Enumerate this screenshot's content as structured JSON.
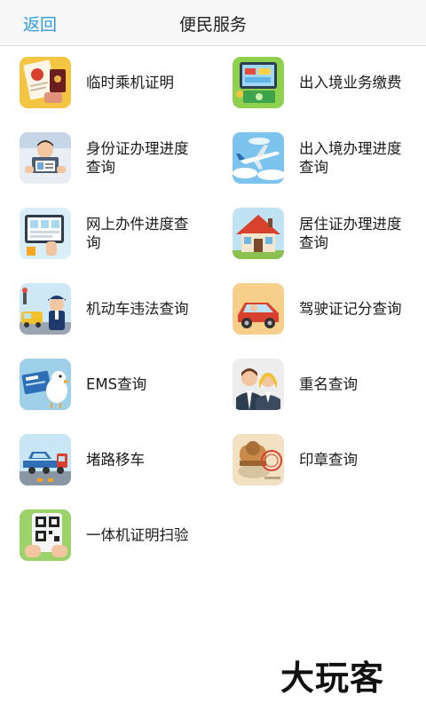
{
  "header": {
    "back_label": "返回",
    "title": "便民服务"
  },
  "services": [
    {
      "label": "临时乘机证明",
      "icon": "passport-certificate-icon"
    },
    {
      "label": "出入境业务缴费",
      "icon": "phone-payment-icon"
    },
    {
      "label": "身份证办理进度查询",
      "icon": "id-card-icon"
    },
    {
      "label": "出入境办理进度查询",
      "icon": "airplane-icon"
    },
    {
      "label": "网上办件进度查询",
      "icon": "tablet-forms-icon"
    },
    {
      "label": "居住证办理进度查询",
      "icon": "house-icon"
    },
    {
      "label": "机动车违法查询",
      "icon": "traffic-police-icon"
    },
    {
      "label": "驾驶证记分查询",
      "icon": "car-driver-icon"
    },
    {
      "label": "EMS查询",
      "icon": "ems-bird-icon"
    },
    {
      "label": "重名查询",
      "icon": "two-people-icon"
    },
    {
      "label": "堵路移车",
      "icon": "tow-truck-icon"
    },
    {
      "label": "印章查询",
      "icon": "stamp-icon"
    },
    {
      "label": "一体机证明扫验",
      "icon": "qr-scan-icon"
    }
  ],
  "watermark": "大玩客"
}
